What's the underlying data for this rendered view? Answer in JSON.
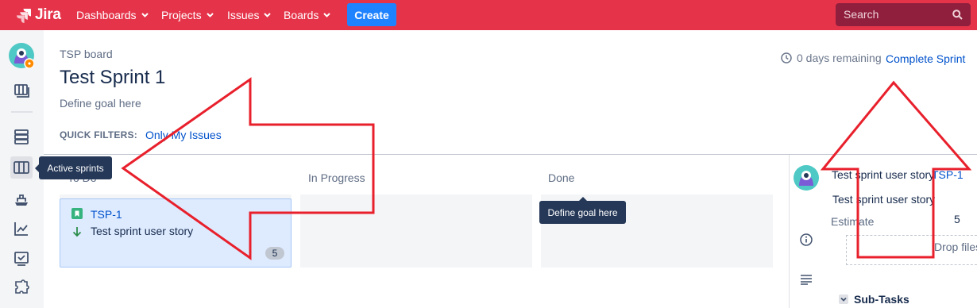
{
  "nav": {
    "logo_text": "Jira",
    "items": [
      "Dashboards",
      "Projects",
      "Issues",
      "Boards"
    ],
    "create_label": "Create",
    "search_placeholder": "Search",
    "bar_color": "#e5344a"
  },
  "sidebar": {
    "icons": [
      "project-avatar",
      "board-icon",
      "backlog-icon",
      "active-sprints-icon",
      "releases-icon",
      "reports-icon",
      "issues-icon",
      "add-ons-icon"
    ],
    "active": "active-sprints-icon",
    "tooltip": "Active sprints"
  },
  "header": {
    "breadcrumb": "TSP board",
    "title": "Test Sprint 1",
    "goal": "Define goal here",
    "remaining": "0 days remaining",
    "complete_label": "Complete Sprint",
    "quick_filters_label": "QUICK FILTERS:",
    "quick_filters": [
      "Only My Issues"
    ]
  },
  "board": {
    "columns": [
      "To Do",
      "In Progress",
      "Done"
    ],
    "tooltip": "Define goal here",
    "cards": [
      {
        "key": "TSP-1",
        "summary": "Test sprint user story",
        "points": "5",
        "type_icon": "story-icon",
        "priority_icon": "priority-low-icon"
      }
    ]
  },
  "detail": {
    "title": "Test sprint user story",
    "key": "TSP-1",
    "summary": "Test sprint user story",
    "estimate_label": "Estimate",
    "estimate_value": "5",
    "attach_text": "Drop files to attach",
    "subtasks_label": "Sub-Tasks"
  },
  "annotation": {
    "arrow_color": "#e8202c"
  }
}
